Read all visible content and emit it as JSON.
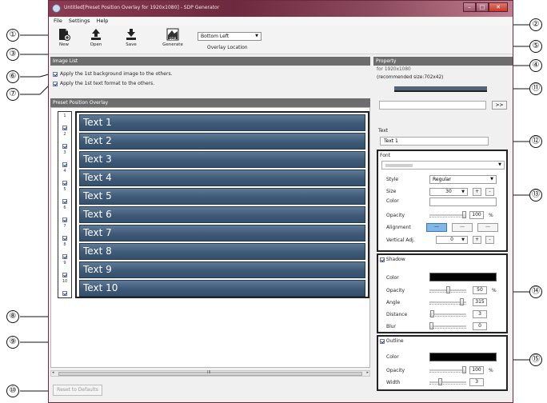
{
  "window": {
    "title": "Untitled[Preset Position Overlay for 1920x1080] - SDP Generator",
    "minimize": "–",
    "maximize": "□",
    "close": "✕"
  },
  "menu": [
    "File",
    "Settings",
    "Help"
  ],
  "toolbar": {
    "new_label": "New",
    "open_label": "Open",
    "save_label": "Save",
    "generate_label": "Generate",
    "overlay_location_value": "Bottom Left",
    "overlay_location_label": "Overlay Location"
  },
  "image_list": {
    "header": "Image List",
    "apply_background": "Apply the 1st background image to the others.",
    "apply_text_format": "Apply the 1st text format to the others."
  },
  "preset_panel": {
    "header": "Preset Position Overlay",
    "rows": [
      {
        "num": "1",
        "text": "Text 1"
      },
      {
        "num": "2",
        "text": "Text 2"
      },
      {
        "num": "3",
        "text": "Text 3"
      },
      {
        "num": "4",
        "text": "Text 4"
      },
      {
        "num": "5",
        "text": "Text 5"
      },
      {
        "num": "6",
        "text": "Text 6"
      },
      {
        "num": "7",
        "text": "Text 7"
      },
      {
        "num": "8",
        "text": "Text 8"
      },
      {
        "num": "9",
        "text": "Text 9"
      },
      {
        "num": "10",
        "text": "Text 10"
      }
    ],
    "scroll_grip": "III",
    "reset_label": "Reset to Defaults"
  },
  "property": {
    "header": "Property",
    "for_line": "for 1920x1080",
    "size_hint": "(recommended size:702x42)",
    "browse_label": ">>",
    "text_label": "Text",
    "text_value": "Text 1",
    "font": {
      "header": "Font",
      "font_name": "Arial",
      "style_label": "Style",
      "style_value": "Regular",
      "size_label": "Size",
      "size_value": "30",
      "color_label": "Color",
      "opacity_label": "Opacity",
      "opacity_value": "100",
      "percent": "%",
      "alignment_label": "Alignment",
      "align_left": "---",
      "align_center": "---",
      "align_right": "---",
      "vertical_label": "Vertical Adj.",
      "vertical_value": "0",
      "plus": "+",
      "minus": "-"
    },
    "shadow": {
      "header": "Shadow",
      "color_label": "Color",
      "opacity_label": "Opacity",
      "opacity_value": "50",
      "percent": "%",
      "angle_label": "Angle",
      "angle_value": "315",
      "distance_label": "Distance",
      "distance_value": "3",
      "blur_label": "Blur",
      "blur_value": "0"
    },
    "outline": {
      "header": "Outline",
      "color_label": "Color",
      "opacity_label": "Opacity",
      "opacity_value": "100",
      "percent": "%",
      "width_label": "Width",
      "width_value": "3"
    }
  },
  "callouts": [
    "①",
    "②",
    "③",
    "④",
    "⑤",
    "⑥",
    "⑦",
    "⑧",
    "⑨",
    "⑩",
    "⑪",
    "⑫",
    "⑬",
    "⑭",
    "⑮"
  ],
  "colors": {
    "text_row": "#3e5a78",
    "title_bar": "#6d2a3f",
    "section_bar": "#6d6d6d"
  }
}
